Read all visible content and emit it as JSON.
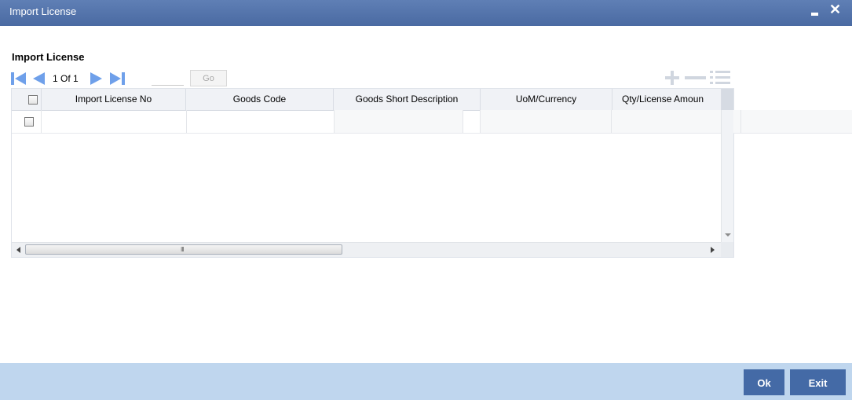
{
  "window": {
    "title": "Import License",
    "minimize_icon": "minimize-icon",
    "close_glyph": "✕"
  },
  "section": {
    "label": "Import License"
  },
  "pager": {
    "page_text": "1 Of 1",
    "page_input_value": "",
    "go_label": "Go"
  },
  "grid": {
    "columns": [
      "Import License No",
      "Goods Code",
      "Goods Short Description",
      "UoM/Currency",
      "Qty/License Amoun"
    ],
    "hscroll_grip": "III"
  },
  "footer": {
    "ok_label": "Ok",
    "exit_label": "Exit"
  },
  "colors": {
    "titlebar": "#4a6aa2",
    "footer": "#bfd6ee",
    "button": "#446aa6",
    "nav_arrow": "#6fa0ea"
  }
}
